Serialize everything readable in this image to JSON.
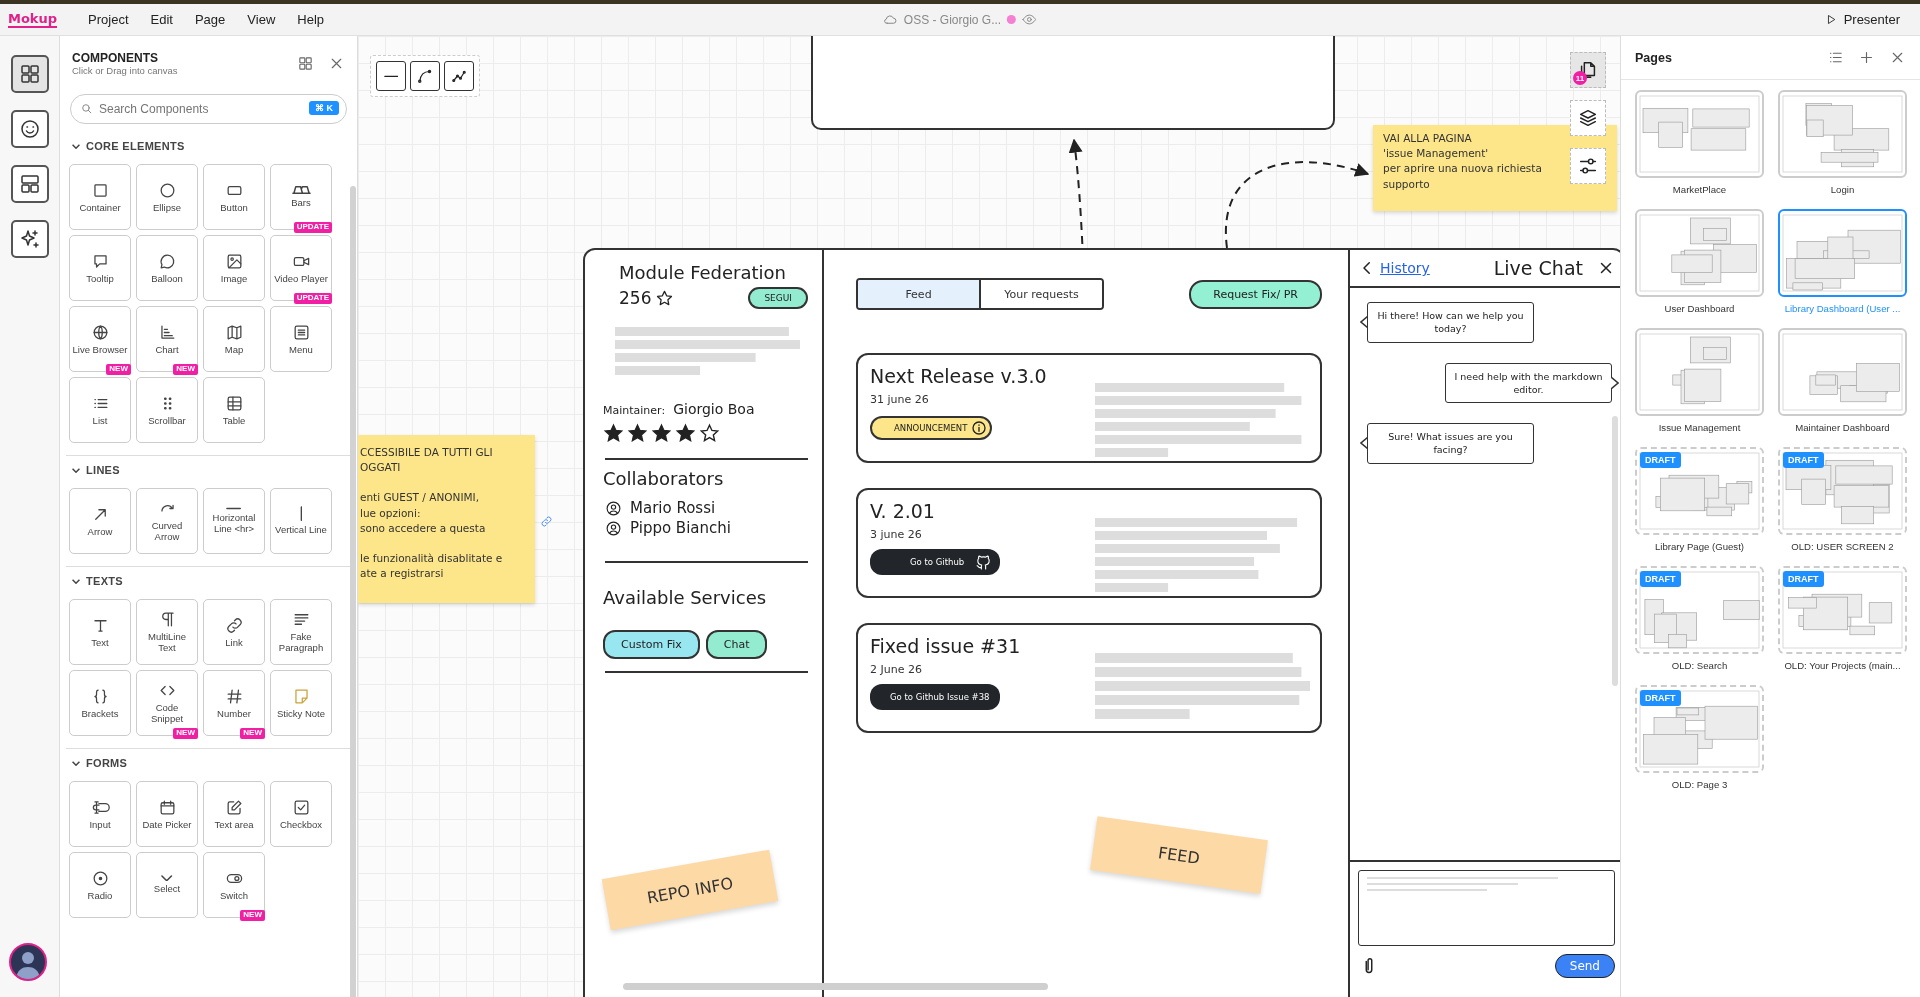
{
  "top_bar": {
    "logo": "Mokup",
    "menu": [
      "Project",
      "Edit",
      "Page",
      "View",
      "Help"
    ],
    "document_title": "OSS - Giorgio G...",
    "presenter": "Presenter"
  },
  "rail": [
    {
      "selected": true
    },
    {
      "selected": false
    },
    {
      "selected": false
    },
    {
      "selected": false
    }
  ],
  "components": {
    "title": "COMPONENTS",
    "subtitle": "Click or Drag into canvas",
    "search": {
      "placeholder": "Search Components",
      "shortcut": "⌘ K"
    },
    "sections": [
      {
        "title": "CORE ELEMENTS",
        "expanded": true,
        "items": [
          {
            "label": "Container"
          },
          {
            "label": "Ellipse"
          },
          {
            "label": "Button"
          },
          {
            "label": "Bars",
            "badge": "UPDATE"
          },
          {
            "label": "Tooltip"
          },
          {
            "label": "Balloon"
          },
          {
            "label": "Image"
          },
          {
            "label": "Video Player",
            "badge": "UPDATE"
          },
          {
            "label": "Live Browser",
            "badge": "NEW"
          },
          {
            "label": "Chart",
            "badge": "NEW"
          },
          {
            "label": "Map"
          },
          {
            "label": "Menu"
          },
          {
            "label": "List"
          },
          {
            "label": "Scrollbar"
          },
          {
            "label": "Table"
          }
        ]
      },
      {
        "title": "LINES",
        "expanded": true,
        "items": [
          {
            "label": "Arrow"
          },
          {
            "label": "Curved Arrow"
          },
          {
            "label": "Horizontal Line <hr>"
          },
          {
            "label": "Vertical Line"
          }
        ]
      },
      {
        "title": "TEXTS",
        "expanded": true,
        "items": [
          {
            "label": "Text"
          },
          {
            "label": "MultiLine Text"
          },
          {
            "label": "Link"
          },
          {
            "label": "Fake Paragraph"
          },
          {
            "label": "Brackets"
          },
          {
            "label": "Code Snippet",
            "badge": "NEW"
          },
          {
            "label": "Number",
            "badge": "NEW"
          },
          {
            "label": "Sticky Note"
          }
        ]
      },
      {
        "title": "FORMS",
        "expanded": true,
        "items": [
          {
            "label": "Input"
          },
          {
            "label": "Date Picker"
          },
          {
            "label": "Text area"
          },
          {
            "label": "Checkbox"
          },
          {
            "label": "Radio"
          },
          {
            "label": "Select"
          },
          {
            "label": "Switch",
            "badge": "NEW"
          }
        ]
      }
    ]
  },
  "canvas": {
    "canvas_toolbar": [
      {
        "selected": true,
        "badge": "11"
      },
      {
        "selected": false
      },
      {
        "selected": false
      }
    ],
    "note_right": {
      "lines": [
        "VAI ALLA PAGINA",
        "'issue Management'",
        "per aprire una nuova richiesta",
        "supporto"
      ]
    },
    "note_left": {
      "paragraphs": [
        [
          "CCESSIBILE DA TUTTI GLI",
          "OGGATI"
        ],
        [
          "enti GUEST / ANONIMI,",
          "lue opzioni:",
          "sono accedere a questa"
        ],
        [
          "le funzionalità disablitate e",
          "ate a registrarsi"
        ]
      ]
    },
    "repo": {
      "name": "Module Federation",
      "star_count": "256",
      "follow": "SEGUI",
      "maintainer_label": "Maintainer:",
      "maintainer": "Giorgio Boa",
      "stars": 4,
      "collaborators_title": "Collaborators",
      "collaborators": [
        "Mario Rossi",
        "Pippo Bianchi"
      ],
      "services_title": "Available Services",
      "services": [
        {
          "label": "Custom Fix",
          "color": "#97e6f0"
        },
        {
          "label": "Chat",
          "color": "#93ecd0"
        }
      ]
    },
    "labels": [
      {
        "text": "REPO INFO"
      },
      {
        "text": "FEED"
      }
    ],
    "tabs": [
      {
        "label": "Feed",
        "selected": true
      },
      {
        "label": "Your requests",
        "selected": false
      }
    ],
    "request_button": "Request Fix/ PR",
    "feed": [
      {
        "title": "Next Release v.3.0",
        "date": "31 june 26",
        "action": {
          "kind": "tag",
          "label": "ANNOUNCEMENT"
        }
      },
      {
        "title": "V. 2.01",
        "date": "3 june 26",
        "action": {
          "kind": "github",
          "label": "Go to Github"
        }
      },
      {
        "title": "Fixed issue #31",
        "date": "2 June 26",
        "action": {
          "kind": "github",
          "label": "Go to Github Issue #38"
        }
      }
    ],
    "chat": {
      "history": "History",
      "title": "Live Chat",
      "send": "Send",
      "messages": [
        {
          "kind": "received",
          "text": "Hi there! How can we help you today?"
        },
        {
          "kind": "sent",
          "text": "I need help with the markdown editor."
        },
        {
          "kind": "received",
          "text": "Sure! What issues are you facing?"
        }
      ]
    }
  },
  "pages": {
    "title": "Pages",
    "items": [
      {
        "label": "MarketPlace",
        "selected": false,
        "draft": false
      },
      {
        "label": "Login",
        "selected": false,
        "draft": false
      },
      {
        "label": "User Dashboard",
        "selected": false,
        "draft": false
      },
      {
        "label": "Library Dashboard (User ...",
        "selected": true,
        "draft": false
      },
      {
        "label": "Issue Management",
        "selected": false,
        "draft": false
      },
      {
        "label": "Maintainer Dashboard",
        "selected": false,
        "draft": false
      },
      {
        "label": "Library Page (Guest)",
        "selected": false,
        "draft": true,
        "badge": "DRAFT"
      },
      {
        "label": "OLD: USER SCREEN 2",
        "selected": false,
        "draft": true,
        "badge": "DRAFT"
      },
      {
        "label": "OLD: Search",
        "selected": false,
        "draft": true,
        "badge": "DRAFT"
      },
      {
        "label": "OLD: Your Projects (main...",
        "selected": false,
        "draft": true,
        "badge": "DRAFT"
      },
      {
        "label": "OLD: Page 3",
        "selected": false,
        "draft": true,
        "badge": "DRAFT"
      }
    ]
  }
}
